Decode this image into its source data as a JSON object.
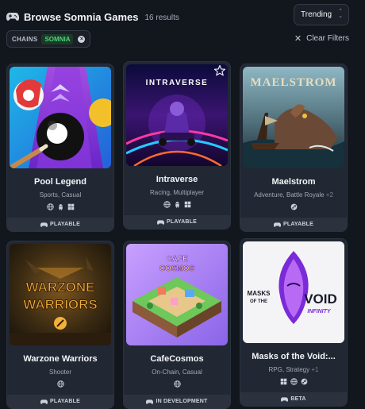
{
  "header": {
    "title": "Browse Somnia Games",
    "result_count": "16 results"
  },
  "sort": {
    "label": "Trending"
  },
  "filters": {
    "chips": [
      {
        "key": "CHAINS",
        "value": "SOMNIA"
      }
    ],
    "clear_label": "Clear Filters"
  },
  "games": [
    {
      "name": "Pool Legend",
      "genres": "Sports, Casual",
      "more": "",
      "platforms": [
        "globe-icon",
        "android-icon",
        "windows-icon"
      ],
      "status": "PLAYABLE",
      "favorite": false
    },
    {
      "name": "Intraverse",
      "genres": "Racing, Multiplayer",
      "more": "",
      "platforms": [
        "globe-icon",
        "android-icon",
        "windows-icon"
      ],
      "status": "PLAYABLE",
      "favorite": true,
      "logo_text": "INTRAVERSE"
    },
    {
      "name": "Maelstrom",
      "genres": "Adventure, Battle Royale",
      "more": "+2",
      "platforms": [
        "steam-icon"
      ],
      "status": "PLAYABLE",
      "favorite": false,
      "logo_text": "MAELSTROM"
    },
    {
      "name": "Warzone Warriors",
      "genres": "Shooter",
      "more": "",
      "platforms": [
        "globe-icon"
      ],
      "status": "PLAYABLE",
      "favorite": false,
      "logo_line1": "WARZONE",
      "logo_line2": "WARRIORS"
    },
    {
      "name": "CafeCosmos",
      "genres": "On-Chain, Casual",
      "more": "",
      "platforms": [
        "globe-icon"
      ],
      "status": "IN DEVELOPMENT",
      "favorite": false,
      "logo_line1": "CAFE",
      "logo_line2": "COSMOS"
    },
    {
      "name": "Masks of the Void:...",
      "genres": "RPG, Strategy",
      "more": "+1",
      "platforms": [
        "windows-icon",
        "globe-icon",
        "steam-icon"
      ],
      "status": "BETA",
      "favorite": false,
      "logo_line1": "MASKS",
      "logo_line2": "OF THE",
      "logo_line3": "VOID",
      "logo_line4": "INFINITY"
    }
  ]
}
